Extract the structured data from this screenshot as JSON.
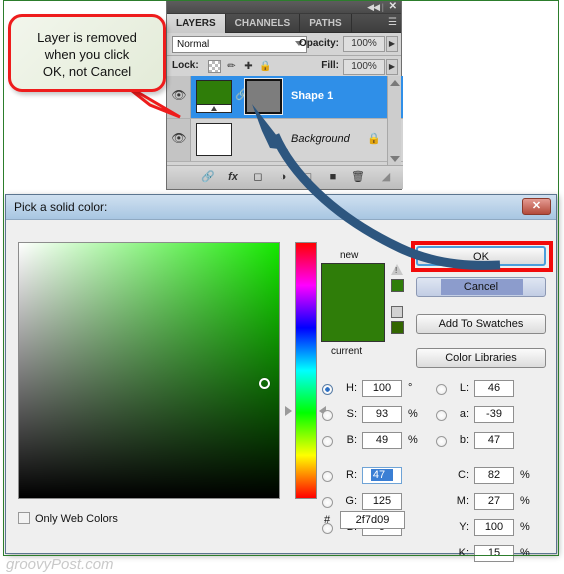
{
  "callout": {
    "line1": "Layer is removed",
    "line2": "when you click",
    "line3": "OK, not Cancel",
    "border_color": "#ee1c1c"
  },
  "layers_panel": {
    "tabs": [
      {
        "label": "LAYERS",
        "active": true
      },
      {
        "label": "CHANNELS",
        "active": false
      },
      {
        "label": "PATHS",
        "active": false
      }
    ],
    "panel_menu_icon": "panel-menu-icon",
    "collapse_icon": "◀◀",
    "close_icon": "✕",
    "blend_mode": "Normal",
    "opacity_label": "Opacity:",
    "opacity_value": "100%",
    "lock_label": "Lock:",
    "lock_icons": [
      "transparency-lock-icon",
      "image-lock-icon",
      "position-lock-icon",
      "all-lock-icon"
    ],
    "fill_label": "Fill:",
    "fill_value": "100%",
    "layers": [
      {
        "name": "Shape 1",
        "selected": true,
        "kind": "shape"
      },
      {
        "name": "Background",
        "selected": false,
        "kind": "background"
      }
    ],
    "footer_icons": [
      "link-layers-icon",
      "layer-style-fx-icon",
      "layer-mask-icon",
      "adjustment-layer-icon",
      "new-group-icon",
      "new-layer-icon",
      "delete-layer-icon"
    ]
  },
  "dialog": {
    "title": "Pick a solid color:",
    "close_label": "✕",
    "labels": {
      "new": "new",
      "current": "current",
      "only_web_colors": "Only Web Colors",
      "hex_hash": "#"
    },
    "buttons": {
      "ok": "OK",
      "cancel": "Cancel",
      "add_to_swatches": "Add To Swatches",
      "color_libraries": "Color Libraries"
    },
    "highlight_color": "#f20a0a",
    "swatch_new_color": "#2f7d09",
    "swatch_current_color": "#2f7d09",
    "hex_value": "2f7d09",
    "only_web_colors_checked": false,
    "hsb": [
      {
        "key": "H",
        "value": "100",
        "unit": "°",
        "selected": true
      },
      {
        "key": "S",
        "value": "93",
        "unit": "%",
        "selected": false
      },
      {
        "key": "B",
        "value": "49",
        "unit": "%",
        "selected": false
      }
    ],
    "rgb": [
      {
        "key": "R",
        "value": "47",
        "unit": "",
        "selected": false,
        "focused": true
      },
      {
        "key": "G",
        "value": "125",
        "unit": "",
        "selected": false,
        "focused": false
      },
      {
        "key": "B",
        "value": "9",
        "unit": "",
        "selected": false,
        "focused": false
      }
    ],
    "lab": [
      {
        "key": "L",
        "value": "46",
        "unit": "",
        "selected": false
      },
      {
        "key": "a",
        "value": "-39",
        "unit": "",
        "selected": false
      },
      {
        "key": "b",
        "value": "47",
        "unit": "",
        "selected": false
      }
    ],
    "cmyk": [
      {
        "key": "C",
        "value": "82",
        "unit": "%"
      },
      {
        "key": "M",
        "value": "27",
        "unit": "%"
      },
      {
        "key": "Y",
        "value": "100",
        "unit": "%"
      },
      {
        "key": "K",
        "value": "15",
        "unit": "%"
      }
    ]
  },
  "watermark": "groovyPost.com"
}
